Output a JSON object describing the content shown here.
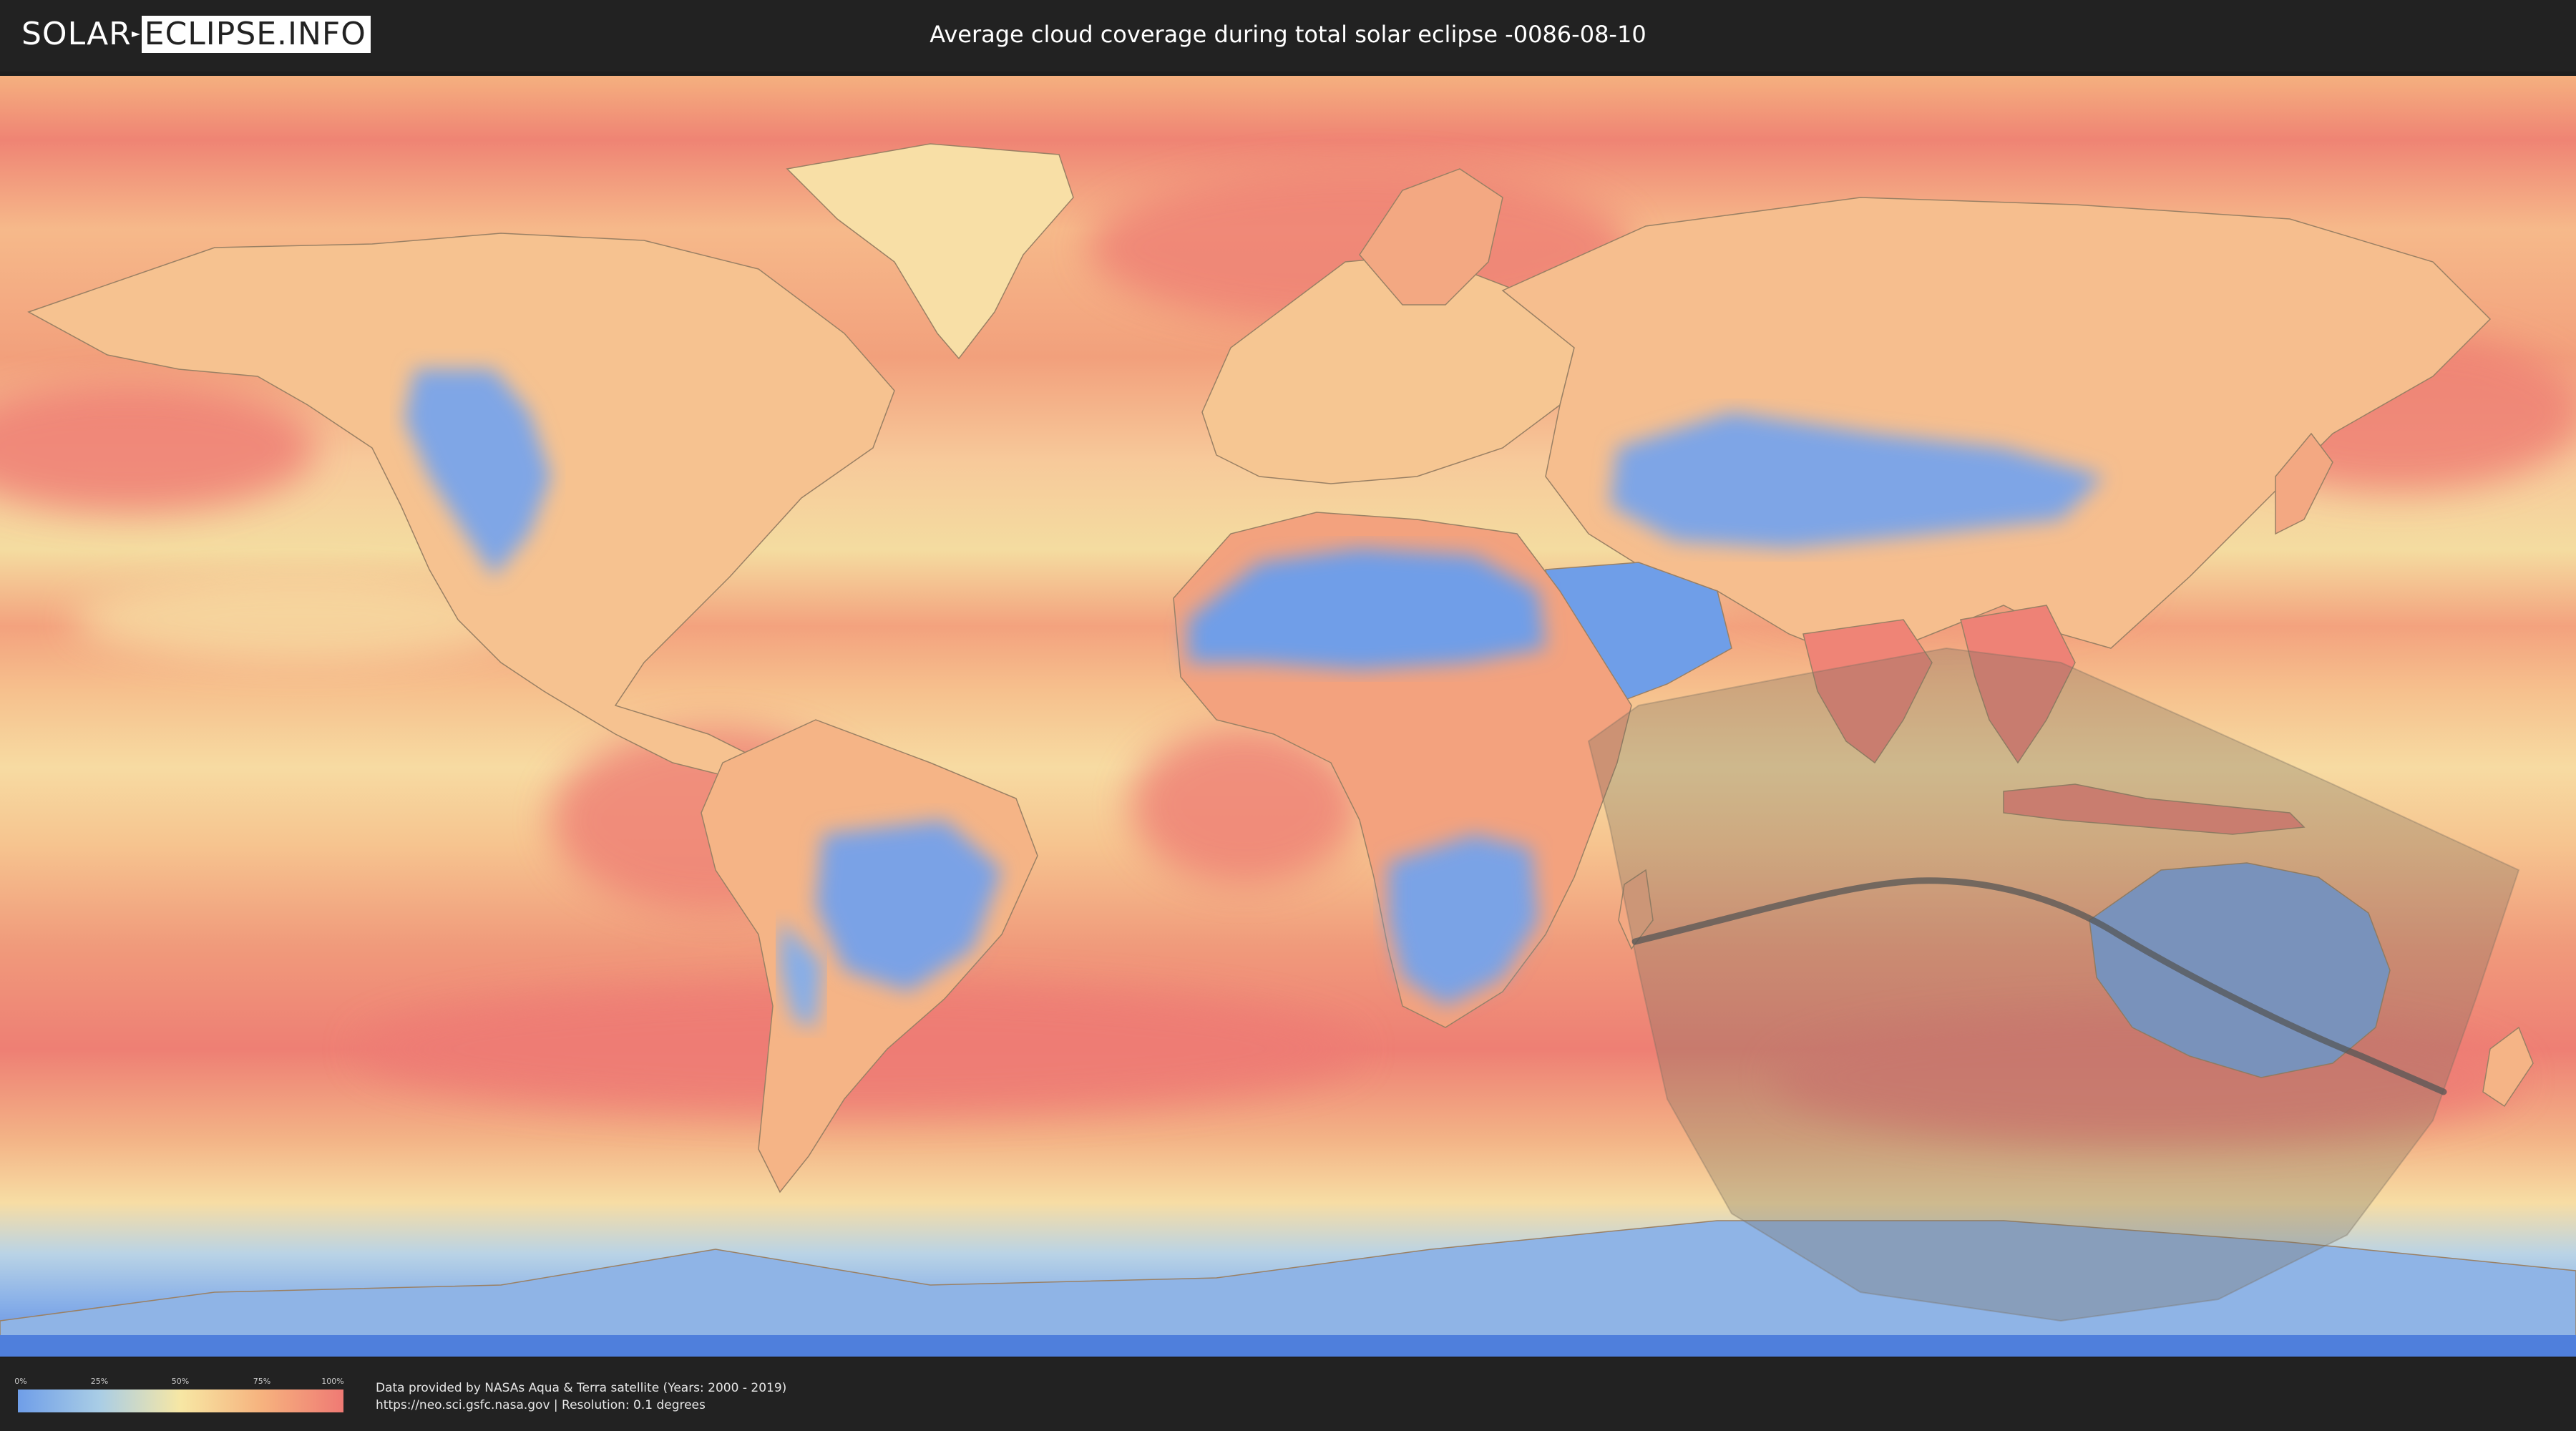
{
  "header": {
    "logo_solar": "SOLAR",
    "logo_eclipse": "ECLIPSE.INFO",
    "title": "Average cloud coverage during total solar eclipse -0086-08-10"
  },
  "map": {
    "type": "cloud-coverage world map",
    "projection": "equirectangular",
    "eclipse_date": "-0086-08-10",
    "overlay_color": "#7a6f60",
    "path_color": "#555555"
  },
  "legend": {
    "ticks": [
      "0%",
      "25%",
      "50%",
      "75%",
      "100%"
    ],
    "colors": [
      "#6f9ee8",
      "#a9cde6",
      "#f7e7a4",
      "#f6b27e",
      "#ef7a74"
    ]
  },
  "footer": {
    "credit_line1": "Data provided by NASAs Aqua & Terra satellite (Years: 2000 - 2019)",
    "credit_line2": "https://neo.sci.gsfc.nasa.gov | Resolution: 0.1 degrees"
  },
  "colors": {
    "background": "#222222",
    "low_cloud": "#6f9ee8",
    "mid_cloud": "#f7e7a4",
    "high_cloud": "#ef7a74"
  }
}
